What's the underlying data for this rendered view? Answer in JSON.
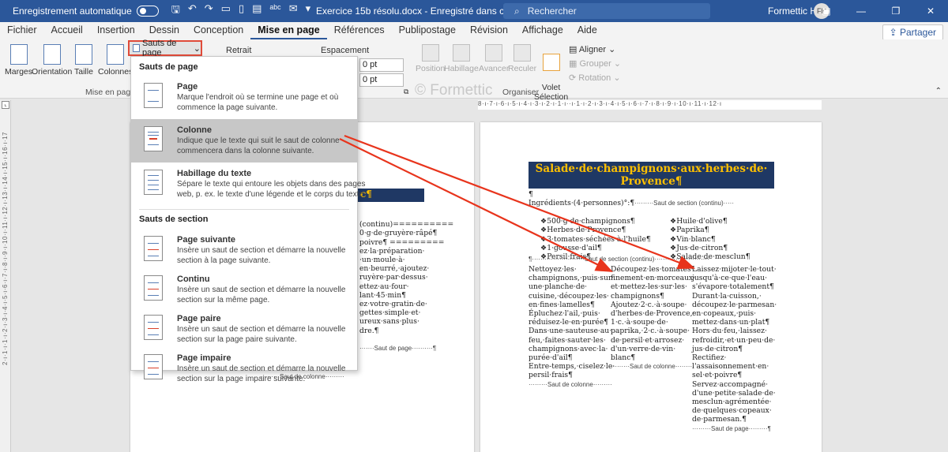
{
  "titlebar": {
    "autosave_label": "Enregistrement automatique",
    "document_title": "Exercice 15b résolu.docx  -  Enregistré dans ce PC",
    "search_placeholder": "Rechercher",
    "user_name": "Formettic H",
    "user_initials": "FH"
  },
  "tabs": [
    "Fichier",
    "Accueil",
    "Insertion",
    "Dessin",
    "Conception",
    "Mise en page",
    "Références",
    "Publipostage",
    "Révision",
    "Affichage",
    "Aide"
  ],
  "active_tab": "Mise en page",
  "share_label": "Partager",
  "ribbon": {
    "marges": "Marges",
    "orientation": "Orientation",
    "taille": "Taille",
    "colonnes": "Colonnes",
    "sauts_de_page": "Sauts de page",
    "group_mise_en_page": "Mise en page",
    "retrait": "Retrait",
    "espacement": "Espacement",
    "spacing_before": "0 pt",
    "spacing_after": "0 pt",
    "position": "Position",
    "habillage": "Habillage",
    "avancer": "Avancer",
    "reculer": "Reculer",
    "volet_selection": "Volet\nSélection",
    "aligner": "Aligner",
    "grouper": "Grouper",
    "rotation": "Rotation",
    "group_organiser": "Organiser"
  },
  "watermark": "© Formettic",
  "menu": {
    "section1_title": "Sauts de page",
    "section2_title": "Sauts de section",
    "items": [
      {
        "title": "Page",
        "desc1": "Marque l'endroit où se termine une page et où",
        "desc2": "commence la page suivante."
      },
      {
        "title": "Colonne",
        "desc1": "Indique que le texte qui suit le saut de colonne",
        "desc2": "commencera dans la colonne suivante."
      },
      {
        "title": "Habillage du texte",
        "desc1": "Sépare le texte qui entoure les objets dans des pages",
        "desc2": "web, p. ex. le texte d'une légende et le corps du texte."
      },
      {
        "title": "Page suivante",
        "desc1": "Insère un saut de section et démarre la nouvelle",
        "desc2": "section à la page suivante."
      },
      {
        "title": "Continu",
        "desc1": "Insère un saut de section et démarre la nouvelle",
        "desc2": "section sur la même page."
      },
      {
        "title": "Page paire",
        "desc1": "Insère un saut de section et démarre la nouvelle",
        "desc2": "section sur la page paire suivante."
      },
      {
        "title": "Page impaire",
        "desc1": "Insère un saut de section et démarre la nouvelle",
        "desc2": "section sur la page impaire suivante."
      }
    ]
  },
  "page1": {
    "lines": [
      "(continu)==========",
      "0·g·de·gruyère·râpé¶",
      "poivre¶ =========",
      "",
      "ez·la·préparation·",
      "·un·moule·à·",
      "en·beurré,·ajoutez·",
      "ruyère·par·dessus·",
      "ettez·au·four·",
      "lant·45·min¶",
      "ez·votre·gratin·de·",
      "gettes·simple·et·",
      "ureux·sans·plus·",
      "dre.¶"
    ],
    "page_break": "Saut de page",
    "column_break": "Saut de colonne"
  },
  "page2": {
    "title": "Salade·de·champignons·aux·herbes·de·\nProvence¶",
    "ingredients_label": "Ingrédients·(4·personnes)°:¶",
    "section_continu": "Saut de section (continu)",
    "ingredients_left": [
      "500·g·de·champignons¶",
      "Herbes·de·Provence¶",
      "3·tomates·séchées·à·l'huile¶",
      "1·gousse·d'ail¶",
      "Persil·frais¶"
    ],
    "ingredients_right": [
      "Huile·d'olive¶",
      "Paprika¶",
      "Vin·blanc¶",
      "Jus·de·citron¶",
      "Salade·de·mesclun¶"
    ],
    "col1": [
      "Nettoyez·les·",
      "champignons,·puis·sur·",
      "une·planche·de·",
      "cuisine,·découpez·les·",
      "en·fines·lamelles¶",
      "Épluchez·l'ail,·puis·",
      "réduisez-le·en·purée¶",
      "Dans·une·sauteuse·au·",
      "feu,·faites·sauter·les·",
      "champignons·avec·la·",
      "purée·d'ail¶",
      "Entre-temps,·ciselez·le·",
      "persil·frais¶"
    ],
    "col2": [
      "Découpez·les·tomates·",
      "finement·en·morceaux·",
      "et·mettez-les·sur·les·",
      "champignons¶",
      "Ajoutez·2·c.·à·soupe·",
      "d'herbes·de·Provence,·",
      "1·c.·à·soupe·de·",
      "paprika,·2·c.·à·soupe·",
      "de·persil·et·arrosez·",
      "d'un·verre·de·vin·",
      "blanc¶"
    ],
    "col3": [
      "Laissez·mijoter·le·tout·",
      "jusqu'à·ce·que·l'eau·",
      "s'évapore·totalement¶",
      "Durant·la·cuisson,·",
      "découpez·le·parmesan·",
      "en·copeaux,·puis·",
      "mettez·dans·un·plat¶",
      "Hors·du·feu,·laissez·",
      "refroidir,·et·un·peu·de·",
      "jus·de·citron¶",
      "Rectifiez·",
      "l'assaisonnement·en·",
      "sel·et·poivre¶",
      "Servez·accompagné·",
      "d'une·petite·salade·de·",
      "mesclun·agrémentée·",
      "de·quelques·copeaux·",
      "de·parmesan.¶"
    ],
    "column_break": "Saut de colonne",
    "page_break": "Saut de page"
  },
  "ruler_h": "8·ı·7·ı·6·ı·5·ı·4·ı·3·ı·2·ı·1·ı··ı·1·ı·2·ı·3·ı·4·ı·5·ı·6·ı·7·ı·8·ı·9·ı·10·ı·11·ı·12·ı",
  "ruler_v": "2·ı·1·ı·1·ı·2·ı·3·ı·4·ı·5·ı·6·ı·7·ı·8·ı·9·ı·10·ı·11·ı·12·ı·13·ı·14·ı·15·ı·16·ı·17",
  "colors": {
    "titlebar": "#2b579a",
    "highlight_red": "#e04b3a",
    "arrow": "#e8341c",
    "title_bg": "#1f3864",
    "title_fg": "#ffc000"
  }
}
